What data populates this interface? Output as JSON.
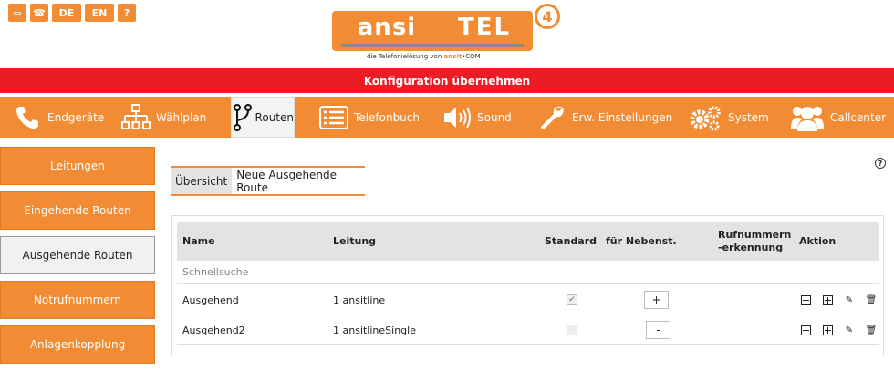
{
  "top_icons": [
    {
      "name": "logout-icon",
      "label": "⇦"
    },
    {
      "name": "phone-icon",
      "label": "☎"
    },
    {
      "name": "lang-de-button",
      "label": "DE"
    },
    {
      "name": "lang-en-button",
      "label": "EN"
    },
    {
      "name": "help-icon",
      "label": "?"
    }
  ],
  "logo": {
    "left": "ansi",
    "right": "TEL",
    "version": "4",
    "tagline_prefix": "die Telefonielösung von ",
    "tagline_brand": "ansit",
    "tagline_suffix": "•COM"
  },
  "config_bar": {
    "label": "Konfiguration übernehmen"
  },
  "nav": [
    {
      "label": "Endgeräte",
      "icon": "phone-icon"
    },
    {
      "label": "Wählplan",
      "icon": "sitemap-icon"
    },
    {
      "label": "Routen",
      "icon": "route-icon",
      "active": true
    },
    {
      "label": "Telefonbuch",
      "icon": "list-icon"
    },
    {
      "label": "Sound",
      "icon": "speaker-icon"
    },
    {
      "label": "Erw. Einstellungen",
      "icon": "wrench-icon"
    },
    {
      "label": "System",
      "icon": "gears-icon"
    },
    {
      "label": "Callcenter",
      "icon": "users-icon"
    }
  ],
  "sidebar": [
    {
      "label": "Leitungen"
    },
    {
      "label": "Eingehende Routen"
    },
    {
      "label": "Ausgehende Routen",
      "active": true
    },
    {
      "label": "Notrufnummern"
    },
    {
      "label": "Anlagenkopplung"
    }
  ],
  "tabs": [
    {
      "label": "Übersicht"
    },
    {
      "label": "Neue Ausgehende Route"
    }
  ],
  "table": {
    "headers": {
      "name": "Name",
      "leitung": "Leitung",
      "standard": "Standard",
      "nebenst": "für Nebenst.",
      "rn1": "Rufnummern",
      "rn2": "-erkennung",
      "aktion": "Aktion"
    },
    "search_label": "Schnellsuche",
    "rows": [
      {
        "name": "Ausgehend",
        "leitung": "1 ansitline",
        "standard_checked": true,
        "nebenst": "+"
      },
      {
        "name": "Ausgehend2",
        "leitung": "1 ansitlineSingle",
        "standard_checked": false,
        "nebenst": "-"
      }
    ]
  },
  "colors": {
    "accent": "#f28c34",
    "alert": "#ec1c24"
  }
}
